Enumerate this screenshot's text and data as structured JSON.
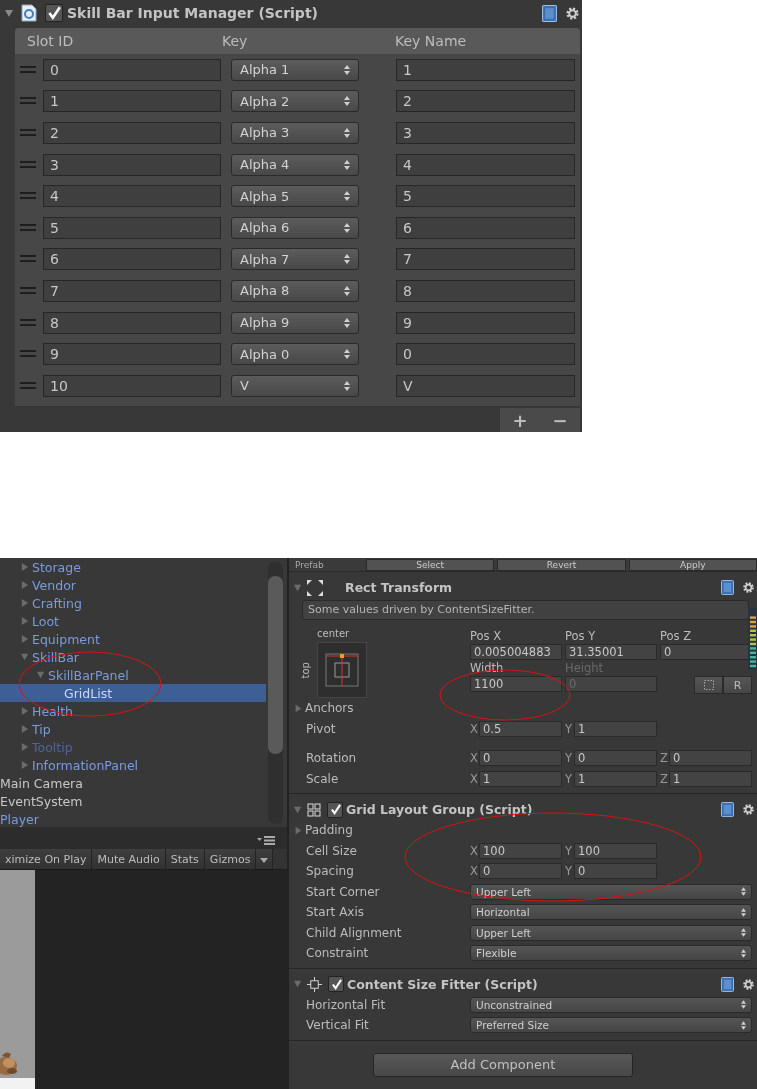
{
  "skill_bar_input_manager": {
    "title": "Skill Bar Input Manager (Script)",
    "expanded": true,
    "enabled": true,
    "columns": [
      "Slot ID",
      "Key",
      "Key Name"
    ],
    "rows": [
      {
        "slot_id": "0",
        "key": "Alpha 1",
        "key_name": "1"
      },
      {
        "slot_id": "1",
        "key": "Alpha 2",
        "key_name": "2"
      },
      {
        "slot_id": "2",
        "key": "Alpha 3",
        "key_name": "3"
      },
      {
        "slot_id": "3",
        "key": "Alpha 4",
        "key_name": "4"
      },
      {
        "slot_id": "4",
        "key": "Alpha 5",
        "key_name": "5"
      },
      {
        "slot_id": "5",
        "key": "Alpha 6",
        "key_name": "6"
      },
      {
        "slot_id": "6",
        "key": "Alpha 7",
        "key_name": "7"
      },
      {
        "slot_id": "7",
        "key": "Alpha 8",
        "key_name": "8"
      },
      {
        "slot_id": "8",
        "key": "Alpha 9",
        "key_name": "9"
      },
      {
        "slot_id": "9",
        "key": "Alpha 0",
        "key_name": "0"
      },
      {
        "slot_id": "10",
        "key": "V",
        "key_name": "V"
      }
    ],
    "footer_buttons": [
      "+",
      "−"
    ]
  },
  "hierarchy": {
    "nested_items": [
      {
        "label": "Storage",
        "prefab": true,
        "active": true,
        "expanded": false,
        "selected": false
      },
      {
        "label": "Vendor",
        "prefab": true,
        "active": true,
        "expanded": false,
        "selected": false
      },
      {
        "label": "Crafting",
        "prefab": true,
        "active": true,
        "expanded": false,
        "selected": false
      },
      {
        "label": "Loot",
        "prefab": true,
        "active": true,
        "expanded": false,
        "selected": false
      },
      {
        "label": "Equipment",
        "prefab": true,
        "active": true,
        "expanded": false,
        "selected": false
      },
      {
        "label": "SkillBar",
        "prefab": true,
        "active": true,
        "expanded": true,
        "selected": false,
        "children": [
          {
            "label": "SkillBarPanel",
            "prefab": true,
            "active": true,
            "expanded": true,
            "selected": false,
            "children": [
              {
                "label": "GridList",
                "prefab": true,
                "active": true,
                "selected": true
              }
            ]
          }
        ]
      },
      {
        "label": "Health",
        "prefab": true,
        "active": true,
        "expanded": false,
        "selected": false
      },
      {
        "label": "Tip",
        "prefab": true,
        "active": true,
        "expanded": false,
        "selected": false
      },
      {
        "label": "Tooltip",
        "prefab": true,
        "active": false,
        "expanded": false,
        "selected": false
      },
      {
        "label": "InformationPanel",
        "prefab": true,
        "active": true,
        "expanded": false,
        "selected": false
      }
    ],
    "root_items": [
      {
        "label": "Main Camera",
        "prefab": false,
        "active": true,
        "selected": false
      },
      {
        "label": "EventSystem",
        "prefab": false,
        "active": true,
        "selected": false
      },
      {
        "label": "Player",
        "prefab": true,
        "active": true,
        "selected": false
      }
    ]
  },
  "game_toolbar": {
    "buttons": [
      "ximize On Play",
      "Mute Audio",
      "Stats",
      "Gizmos"
    ]
  },
  "inspector": {
    "prefab_bar": {
      "label": "Prefab",
      "buttons": [
        "Select",
        "Revert",
        "Apply"
      ]
    },
    "rect_transform": {
      "title": "Rect Transform",
      "expanded": true,
      "notice": "Some values driven by ContentSizeFitter.",
      "anchor_preset": {
        "horizontal": "center",
        "vertical": "top"
      },
      "position": [
        {
          "label": "Pos X",
          "value": "0.005004883"
        },
        {
          "label": "Pos Y",
          "value": "31.35001"
        },
        {
          "label": "Pos Z",
          "value": "0"
        }
      ],
      "size": [
        {
          "label": "Width",
          "value": "1100",
          "disabled": false
        },
        {
          "label": "Height",
          "value": "0",
          "disabled": true
        }
      ],
      "reset_button": "R",
      "anchors": {
        "label": "Anchors",
        "expanded": false
      },
      "vectors": [
        {
          "label": "Pivot",
          "axes": [
            {
              "axis": "X",
              "value": "0.5"
            },
            {
              "axis": "Y",
              "value": "1"
            }
          ]
        },
        {
          "label": "Rotation",
          "axes": [
            {
              "axis": "X",
              "value": "0"
            },
            {
              "axis": "Y",
              "value": "0"
            },
            {
              "axis": "Z",
              "value": "0"
            }
          ]
        },
        {
          "label": "Scale",
          "axes": [
            {
              "axis": "X",
              "value": "1"
            },
            {
              "axis": "Y",
              "value": "1"
            },
            {
              "axis": "Z",
              "value": "1"
            }
          ]
        }
      ]
    },
    "grid_layout_group": {
      "title": "Grid Layout Group (Script)",
      "expanded": true,
      "enabled": true,
      "padding": {
        "label": "Padding",
        "expanded": false
      },
      "fields": [
        {
          "kind": "vector",
          "label": "Cell Size",
          "axes": [
            {
              "axis": "X",
              "value": "100"
            },
            {
              "axis": "Y",
              "value": "100"
            }
          ]
        },
        {
          "kind": "vector",
          "label": "Spacing",
          "axes": [
            {
              "axis": "X",
              "value": "0"
            },
            {
              "axis": "Y",
              "value": "0"
            }
          ]
        },
        {
          "kind": "dropdown",
          "label": "Start Corner",
          "value": "Upper Left"
        },
        {
          "kind": "dropdown",
          "label": "Start Axis",
          "value": "Horizontal"
        },
        {
          "kind": "dropdown",
          "label": "Child Alignment",
          "value": "Upper Left"
        },
        {
          "kind": "dropdown",
          "label": "Constraint",
          "value": "Flexible"
        }
      ]
    },
    "content_size_fitter": {
      "title": "Content Size Fitter (Script)",
      "expanded": true,
      "enabled": true,
      "fields": [
        {
          "kind": "dropdown",
          "label": "Horizontal Fit",
          "value": "Unconstrained"
        },
        {
          "kind": "dropdown",
          "label": "Vertical Fit",
          "value": "Preferred Size"
        }
      ]
    },
    "add_component_button": "Add Component"
  }
}
